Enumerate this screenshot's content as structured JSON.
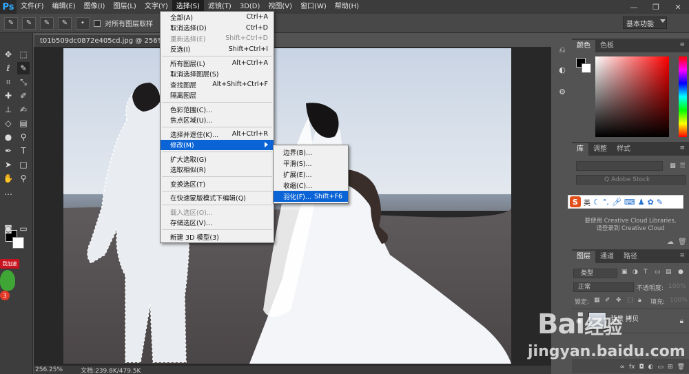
{
  "app": {
    "logo": "Ps"
  },
  "menubar": {
    "items": [
      "文件(F)",
      "编辑(E)",
      "图像(I)",
      "图层(L)",
      "文字(Y)",
      "选择(S)",
      "滤镜(T)",
      "3D(D)",
      "视图(V)",
      "窗口(W)",
      "帮助(H)"
    ],
    "active": "选择(S)"
  },
  "window_controls": {
    "minimize": "—",
    "restore": "❐",
    "close": "✕"
  },
  "optionsbar": {
    "sample_all_layers": "对所有图层取样",
    "workspace": "基本功能"
  },
  "document": {
    "tab_title": "t01b509dc0872e405cd.jpg @ 256% (背景,",
    "zoom": "256.25%",
    "doc_info": "文档:239.8K/479.5K"
  },
  "select_menu": {
    "items": [
      {
        "label": "全部(A)",
        "shortcut": "Ctrl+A",
        "state": "normal"
      },
      {
        "label": "取消选择(D)",
        "shortcut": "Ctrl+D",
        "state": "normal"
      },
      {
        "label": "重新选择(E)",
        "shortcut": "Shift+Ctrl+D",
        "state": "disabled"
      },
      {
        "label": "反选(I)",
        "shortcut": "Shift+Ctrl+I",
        "state": "normal",
        "sep_after": true
      },
      {
        "label": "所有图层(L)",
        "shortcut": "Alt+Ctrl+A",
        "state": "normal"
      },
      {
        "label": "取消选择图层(S)",
        "shortcut": "",
        "state": "normal"
      },
      {
        "label": "查找图层",
        "shortcut": "Alt+Shift+Ctrl+F",
        "state": "normal"
      },
      {
        "label": "隔离图层",
        "shortcut": "",
        "state": "normal",
        "sep_after": true
      },
      {
        "label": "色彩范围(C)...",
        "shortcut": "",
        "state": "normal"
      },
      {
        "label": "焦点区域(U)...",
        "shortcut": "",
        "state": "normal",
        "sep_after": true
      },
      {
        "label": "选择并遮住(K)...",
        "shortcut": "Alt+Ctrl+R",
        "state": "normal"
      },
      {
        "label": "修改(M)",
        "shortcut": "",
        "state": "highlight",
        "submenu": true,
        "sep_after": true
      },
      {
        "label": "扩大选取(G)",
        "shortcut": "",
        "state": "normal"
      },
      {
        "label": "选取相似(R)",
        "shortcut": "",
        "state": "normal",
        "sep_after": true
      },
      {
        "label": "变换选区(T)",
        "shortcut": "",
        "state": "normal",
        "sep_after": true
      },
      {
        "label": "在快速蒙版模式下编辑(Q)",
        "shortcut": "",
        "state": "normal",
        "sep_after": true
      },
      {
        "label": "载入选区(O)...",
        "shortcut": "",
        "state": "disabled"
      },
      {
        "label": "存储选区(V)...",
        "shortcut": "",
        "state": "normal",
        "sep_after": true
      },
      {
        "label": "新建 3D 模型(3)",
        "shortcut": "",
        "state": "normal"
      }
    ]
  },
  "modify_menu": {
    "items": [
      {
        "label": "边界(B)...",
        "shortcut": "",
        "state": "normal"
      },
      {
        "label": "平滑(S)...",
        "shortcut": "",
        "state": "normal"
      },
      {
        "label": "扩展(E)...",
        "shortcut": "",
        "state": "normal"
      },
      {
        "label": "收缩(C)...",
        "shortcut": "",
        "state": "normal"
      },
      {
        "label": "羽化(F)...",
        "shortcut": "Shift+F6",
        "state": "highlight"
      }
    ]
  },
  "panels": {
    "color_tabs": [
      "颜色",
      "色板"
    ],
    "library_tabs": [
      "库",
      "调整",
      "样式"
    ],
    "library_search_placeholder": "Q Adobe Stock",
    "library_message_1": "要使用 Creative Cloud Libraries,",
    "library_message_2": "请登录到 Creative Cloud",
    "ime_label": "英",
    "layers_tabs": [
      "图层",
      "通道",
      "路径"
    ],
    "layers_kind": "类型",
    "blend_mode": "正常",
    "opacity_label": "不透明度:",
    "opacity_value": "100%",
    "lock_label": "锁定:",
    "fill_label": "填充:",
    "fill_value": "100%",
    "layer_name": "背景 拷贝"
  },
  "badge": {
    "label": "我加速",
    "count": "3"
  },
  "watermark": {
    "logo_a": "Bai",
    "logo_b": "经验",
    "url": "jingyan.baidu.com"
  }
}
